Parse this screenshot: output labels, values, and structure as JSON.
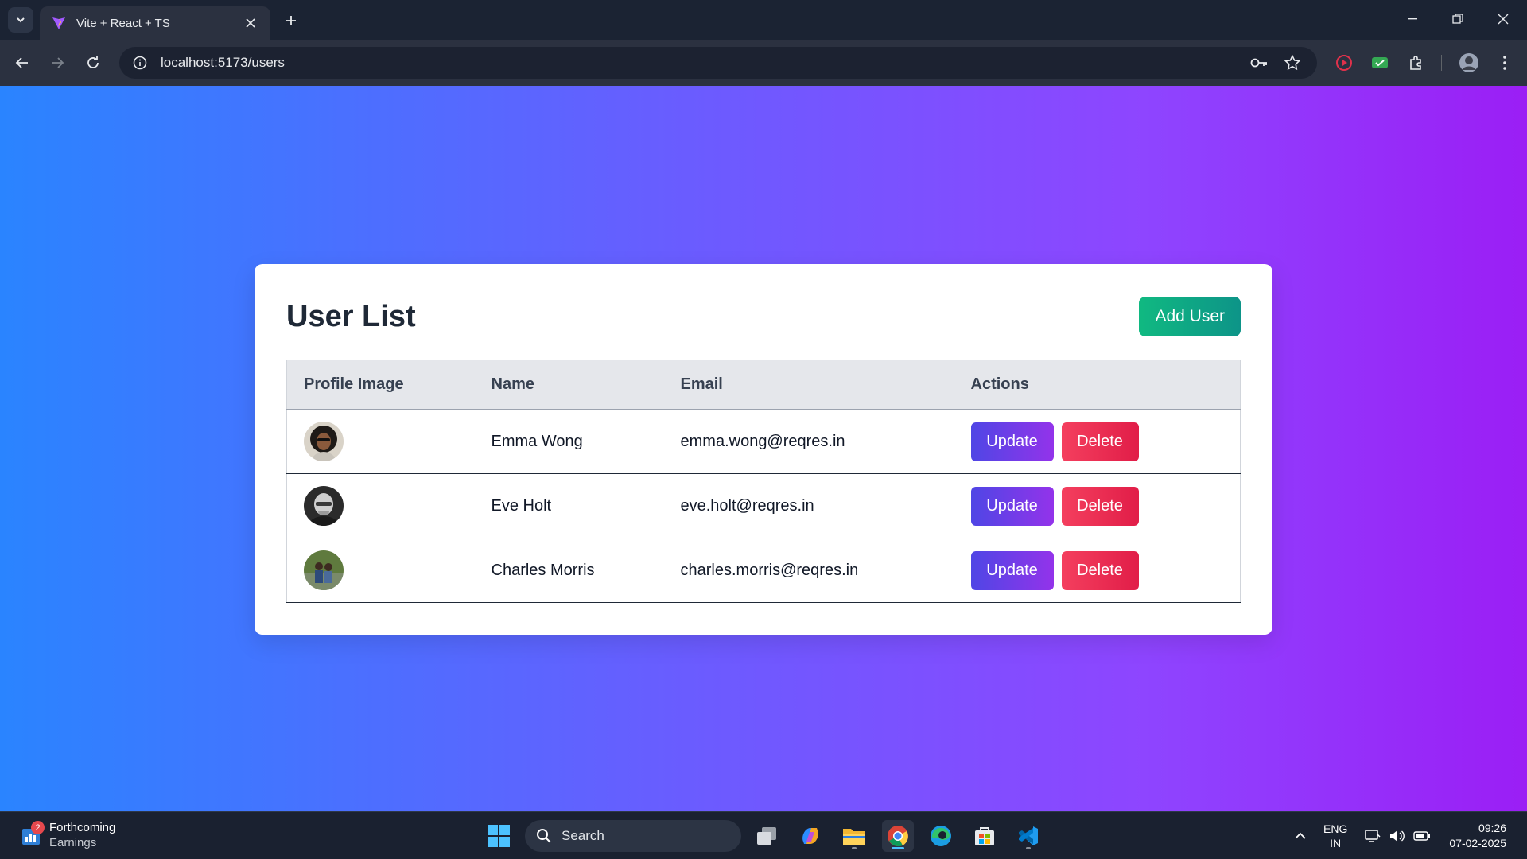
{
  "browser": {
    "tab_title": "Vite + React + TS",
    "url": "localhost:5173/users"
  },
  "page": {
    "title": "User List",
    "add_button": "Add User",
    "columns": [
      "Profile Image",
      "Name",
      "Email",
      "Actions"
    ],
    "update_label": "Update",
    "delete_label": "Delete",
    "users": [
      {
        "name": "Emma Wong",
        "email": "emma.wong@reqres.in"
      },
      {
        "name": "Eve Holt",
        "email": "eve.holt@reqres.in"
      },
      {
        "name": "Charles Morris",
        "email": "charles.morris@reqres.in"
      }
    ]
  },
  "taskbar": {
    "widget_badge": "2",
    "widget_title": "Forthcoming",
    "widget_subtitle": "Earnings",
    "search_label": "Search",
    "lang_line1": "ENG",
    "lang_line2": "IN",
    "time": "09:26",
    "date": "07-02-2025"
  },
  "colors": {
    "gradient_start": "#2a84ff",
    "gradient_end": "#9b1ef5",
    "add_button": "#10b981",
    "update_button": "#6d3ff0",
    "delete_button": "#f0305a"
  }
}
